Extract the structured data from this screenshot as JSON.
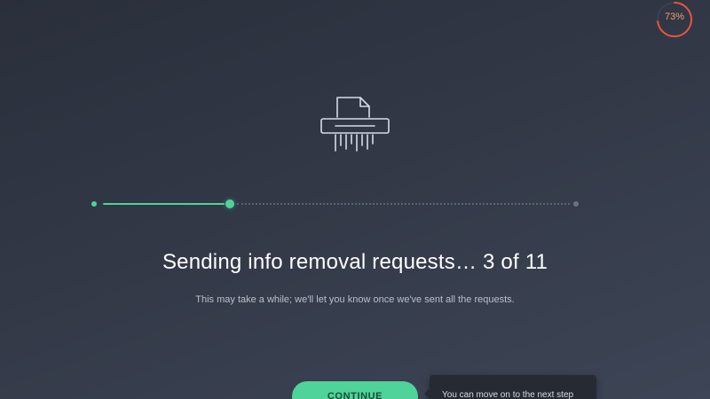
{
  "progress": {
    "percent_label": "73%",
    "percent_value": 0.73,
    "ring_color": "#e8553d",
    "ring_text_color": "#f39c6b"
  },
  "steps": {
    "done": 3,
    "total": 11,
    "accent_color": "#4fd39a"
  },
  "main": {
    "headline": "Sending info removal requests… 3 of 11",
    "subtext": "This may take a while; we'll let you know once we've sent all the requests."
  },
  "actions": {
    "continue_label": "CONTINUE",
    "tooltip_text": "You can move on to the next step"
  },
  "icons": {
    "illustration": "paper-shredder-icon"
  }
}
